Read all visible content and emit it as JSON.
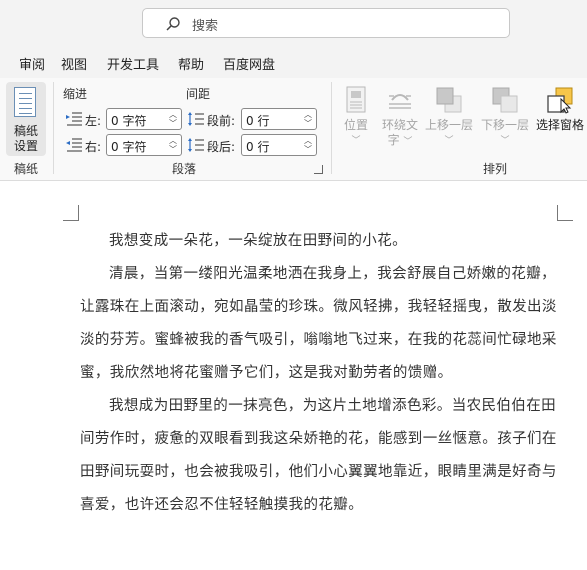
{
  "search": {
    "placeholder": "搜索"
  },
  "menu": {
    "tabs": [
      "审阅",
      "视图",
      "开发工具",
      "帮助",
      "百度网盘"
    ]
  },
  "ribbon": {
    "manuscript": {
      "button_line1": "稿纸",
      "button_line2": "设置",
      "group_label": "稿纸"
    },
    "paragraph": {
      "indent_header": "缩进",
      "spacing_header": "间距",
      "left_label": "左:",
      "left_value": "0 字符",
      "right_label": "右:",
      "right_value": "0 字符",
      "before_label": "段前:",
      "before_value": "0 行",
      "after_label": "段后:",
      "after_value": "0 行",
      "group_label": "段落"
    },
    "arrange": {
      "position_label": "位置",
      "wrap_line1": "环绕文",
      "wrap_line2": "字",
      "bring_forward": "上移一层",
      "send_backward": "下移一层",
      "selection_pane": "选择窗格",
      "group_label": "排列"
    }
  },
  "document": {
    "paragraphs": [
      "我想变成一朵花，一朵绽放在田野间的小花。",
      "清晨，当第一缕阳光温柔地洒在我身上，我会舒展自己娇嫩的花瓣，让露珠在上面滚动，宛如晶莹的珍珠。微风轻拂，我轻轻摇曳，散发出淡淡的芬芳。蜜蜂被我的香气吸引，嗡嗡地飞过来，在我的花蕊间忙碌地采蜜，我欣然地将花蜜赠予它们，这是我对勤劳者的馈赠。",
      "我想成为田野里的一抹亮色，为这片土地增添色彩。当农民伯伯在田间劳作时，疲惫的双眼看到我这朵娇艳的花，能感到一丝惬意。孩子们在田野间玩耍时，也会被我吸引，他们小心翼翼地靠近，眼睛里满是好奇与喜爱，也许还会忍不住轻轻触摸我的花瓣。"
    ]
  }
}
